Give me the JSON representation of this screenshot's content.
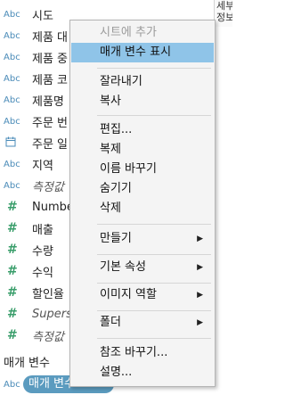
{
  "header": {
    "line1": "세부",
    "line2": "정보"
  },
  "fields": [
    {
      "type": "Abc",
      "label": "시도"
    },
    {
      "type": "Abc",
      "label": "제품 대"
    },
    {
      "type": "Abc",
      "label": "제품 중"
    },
    {
      "type": "Abc",
      "label": "제품 코"
    },
    {
      "type": "Abc",
      "label": "제품명"
    },
    {
      "type": "Abc",
      "label": "주문 번"
    },
    {
      "type": "date",
      "label": "주문 일"
    },
    {
      "type": "Abc",
      "label": "지역"
    },
    {
      "type": "Abc",
      "label": "측정값"
    },
    {
      "type": "#",
      "label": "Number"
    },
    {
      "type": "#",
      "label": "매출"
    },
    {
      "type": "#",
      "label": "수량"
    },
    {
      "type": "#",
      "label": "수익"
    },
    {
      "type": "#",
      "label": "할인율"
    },
    {
      "type": "#",
      "label": "Superst"
    },
    {
      "type": "#",
      "label": "측정값"
    }
  ],
  "parameters": {
    "section_label": "매개 변수",
    "item_type": "Abc",
    "item_label": "매개 변수 1"
  },
  "menu": {
    "add_to_sheet": "시트에 추가",
    "show_parameter": "매개 변수 표시",
    "cut": "잘라내기",
    "copy": "복사",
    "edit": "편집...",
    "duplicate": "복제",
    "rename": "이름 바꾸기",
    "hide": "숨기기",
    "delete": "삭제",
    "create": "만들기",
    "default_properties": "기본 속성",
    "image_role": "이미지 역할",
    "folder": "폴더",
    "replace_references": "참조 바꾸기...",
    "describe": "설명...",
    "submenu_arrow": "▶"
  },
  "colors": {
    "menu_highlight": "#8fc4e8",
    "pill": "#5b9bbf",
    "dimension": "#4a8bb8",
    "measure": "#3a9e6b"
  }
}
